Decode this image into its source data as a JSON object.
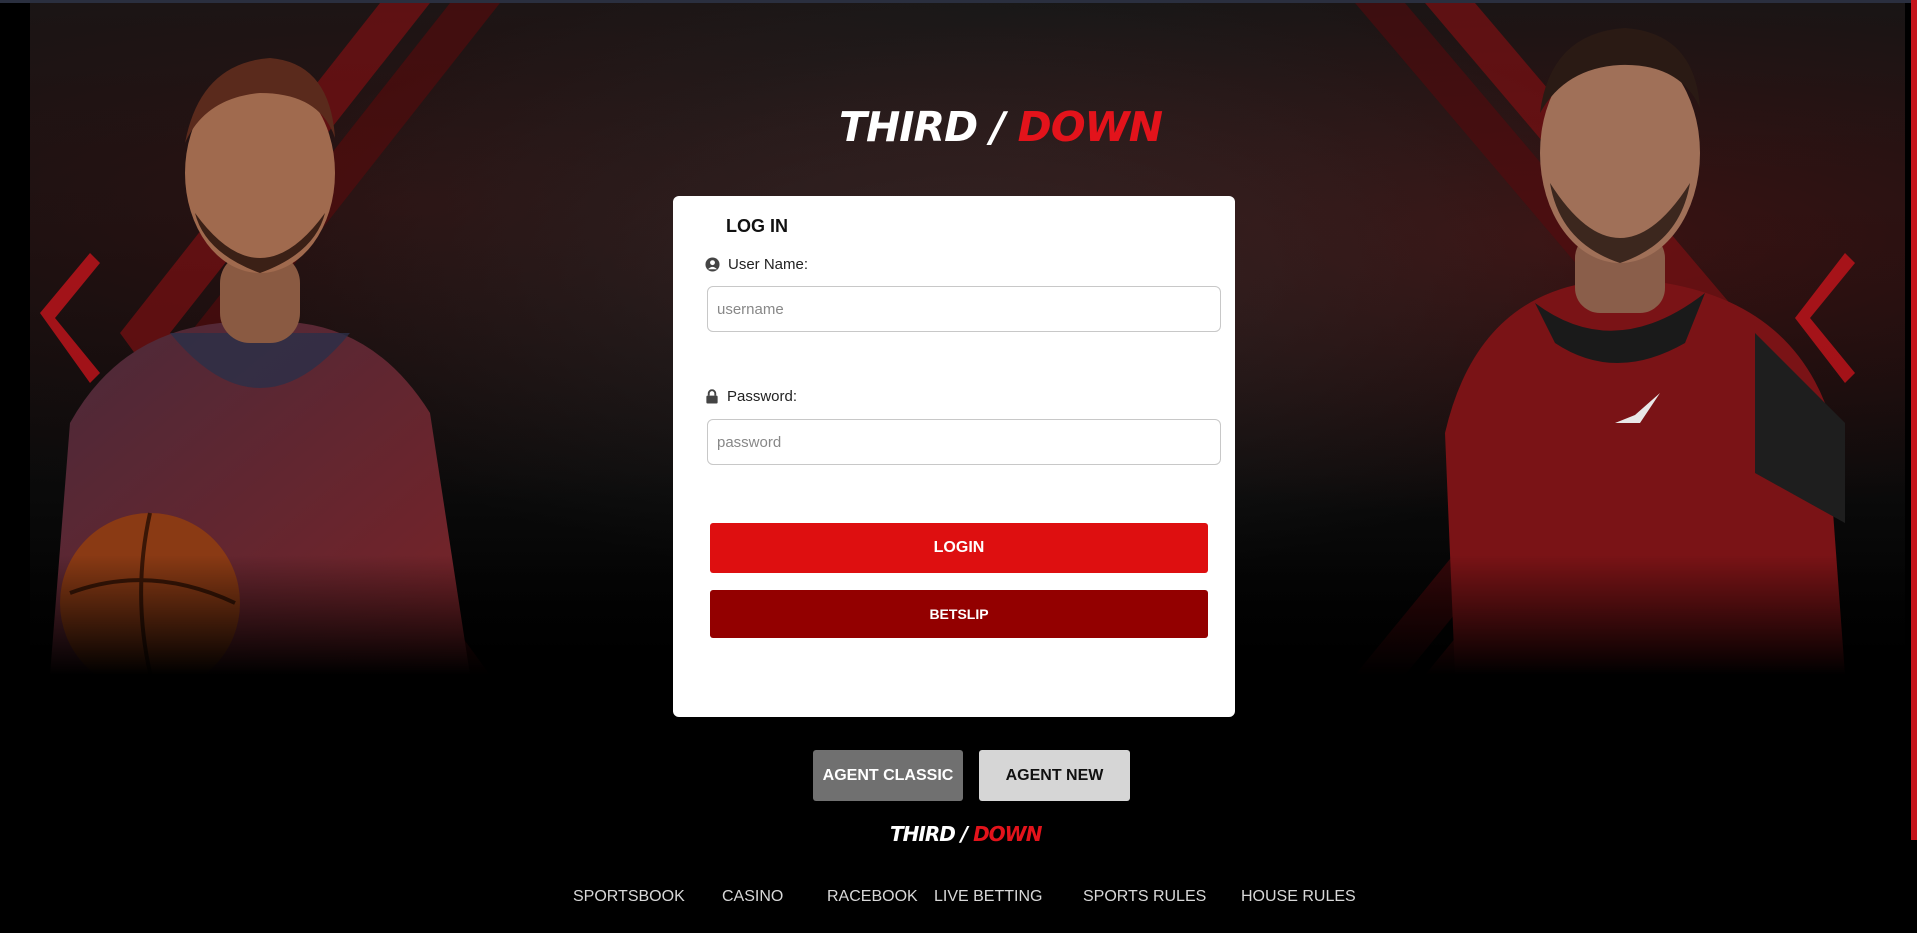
{
  "brand": {
    "logo_part1": "THIRD",
    "logo_sep": " / ",
    "logo_part2": "DOWN",
    "accent_color": "#e3131b"
  },
  "login_card": {
    "title": "LOG IN",
    "username_label": "User Name:",
    "username_placeholder": "username",
    "password_label": "Password:",
    "password_placeholder": "password",
    "login_button": "LOGIN",
    "betslip_button": "BETSLIP"
  },
  "agent_buttons": {
    "classic": "AGENT CLASSIC",
    "new": "AGENT NEW"
  },
  "footer": {
    "links": [
      "SPORTSBOOK",
      "CASINO",
      "RACEBOOK",
      "LIVE BETTING",
      "SPORTS RULES",
      "HOUSE RULES"
    ]
  },
  "icons": {
    "user": "user-circle-icon",
    "lock": "lock-icon"
  },
  "colors": {
    "login_button": "#de0f10",
    "betslip_button": "#930000",
    "agent_classic": "#707070",
    "agent_new": "#d6d6d6"
  }
}
